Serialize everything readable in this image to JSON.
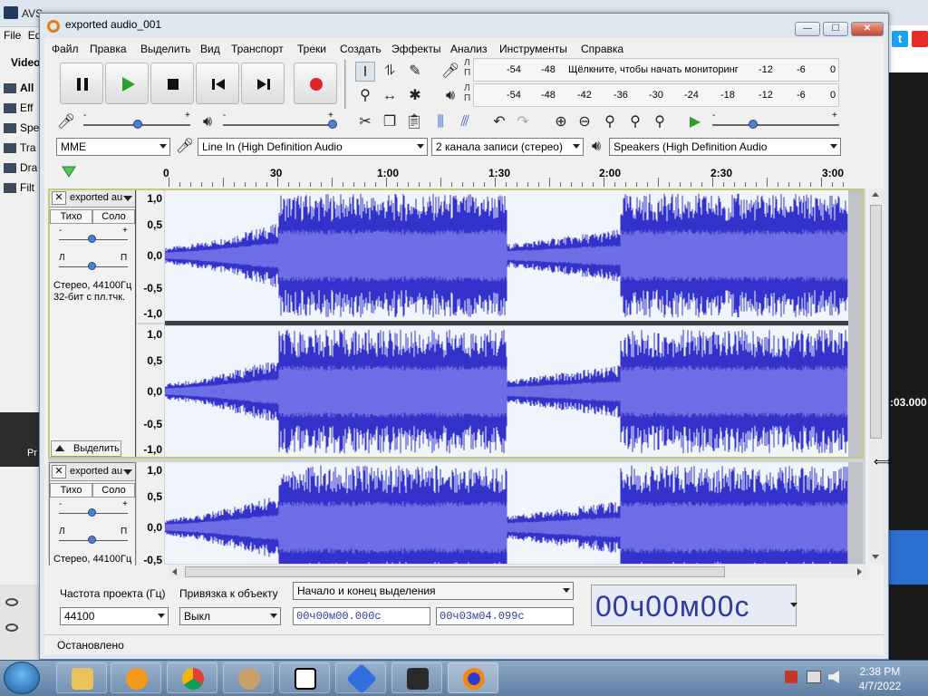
{
  "background_app": {
    "title": "AVS",
    "menu": [
      "File",
      "Edi"
    ],
    "section": "Video",
    "tree": [
      "All",
      "Eff",
      "Spe",
      "Tra",
      "Dra",
      "Filt"
    ],
    "right_time": ":03.000",
    "twitter_glyph": "t",
    "side_label": "Pr"
  },
  "window": {
    "title": "exported audio_001",
    "buttons": {
      "minimize": "—",
      "maximize": "☐",
      "close": "✕"
    }
  },
  "menubar": [
    "Файл",
    "Правка",
    "Выделить",
    "Вид",
    "Транспорт",
    "Треки",
    "Создать",
    "Эффекты",
    "Анализ",
    "Инструменты",
    "Справка"
  ],
  "meters": {
    "channel_l": "Л",
    "channel_r": "П",
    "record_ticks": [
      "-54",
      "-48",
      "-12",
      "-6",
      "0"
    ],
    "monitor_hint": "Щёлкните, чтобы начать мониторинг",
    "playback_ticks": [
      "-54",
      "-48",
      "-42",
      "-36",
      "-30",
      "-24",
      "-18",
      "-12",
      "-6",
      "0"
    ]
  },
  "sliders": {
    "minus": "-",
    "plus": "+"
  },
  "devices": {
    "host": "MME",
    "input": "Line In (High Definition Audio",
    "channels": "2  канала записи (стерео)",
    "output": "Speakers (High Definition Audio"
  },
  "ruler": {
    "labels": [
      "0",
      "30",
      "1:00",
      "1:30",
      "2:00",
      "2:30",
      "3:00"
    ]
  },
  "tracks": [
    {
      "name": "exported au",
      "mute": "Тихо",
      "solo": "Соло",
      "pan_left": "Л",
      "pan_right": "П",
      "info_line1": "Стерео, 44100Гц",
      "info_line2": "32-бит с пл.тчк.",
      "select": "Выделить",
      "scale": [
        "1,0",
        "0,5",
        "0,0",
        "-0,5",
        "-1,0"
      ],
      "scale2": [
        "1,0",
        "0,5",
        "0,0",
        "-0,5",
        "-1,0"
      ]
    },
    {
      "name": "exported au",
      "mute": "Тихо",
      "solo": "Соло",
      "pan_left": "Л",
      "pan_right": "П",
      "info_line1": "Стерео, 44100Гц",
      "scale": [
        "1,0",
        "0,5",
        "0,0",
        "-0,5"
      ]
    }
  ],
  "bottom": {
    "rate_label": "Частота проекта (Гц)",
    "rate_value": "44100",
    "snap_label": "Привязка к объекту",
    "snap_value": "Выкл",
    "selection_mode": "Начало и конец выделения",
    "sel_start": "00ч00м00.000с",
    "sel_end": "00ч03м04.099с",
    "audio_position": "00ч00м00с"
  },
  "status": "Остановлено",
  "taskbar": {
    "time": "2:38 PM",
    "date": "4/7/2022"
  },
  "colors": {
    "wave_dark": "#3333cc",
    "wave_light": "#6d6de6",
    "record": "#e0242e",
    "play": "#2ca02c"
  }
}
